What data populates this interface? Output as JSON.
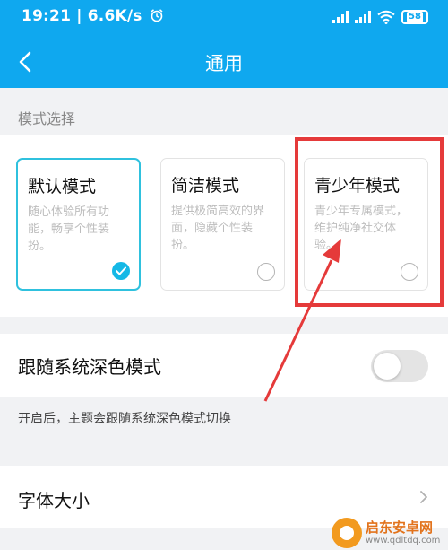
{
  "status_bar": {
    "time": "19:21",
    "speed": "6.6K/s",
    "battery": "58"
  },
  "nav": {
    "title": "通用"
  },
  "mode_section": {
    "title": "模式选择",
    "cards": [
      {
        "name": "默认模式",
        "desc": "随心体验所有功能，畅享个性装扮。",
        "selected": true
      },
      {
        "name": "简洁模式",
        "desc": "提供极简高效的界面，隐藏个性装扮。",
        "selected": false
      },
      {
        "name": "青少年模式",
        "desc": "青少年专属模式，维护纯净社交体验。",
        "selected": false
      }
    ]
  },
  "dark_mode": {
    "label": "跟随系统深色模式",
    "enabled": false,
    "hint": "开启后，主题会跟随系统深色模式切换"
  },
  "font_size": {
    "label": "字体大小"
  },
  "watermark": {
    "name": "启东安卓网",
    "url": "www.qdltdq.com"
  },
  "colors": {
    "header": "#0fa8ef",
    "selected_border": "#2fc1de",
    "annotation": "#e53a3a"
  }
}
